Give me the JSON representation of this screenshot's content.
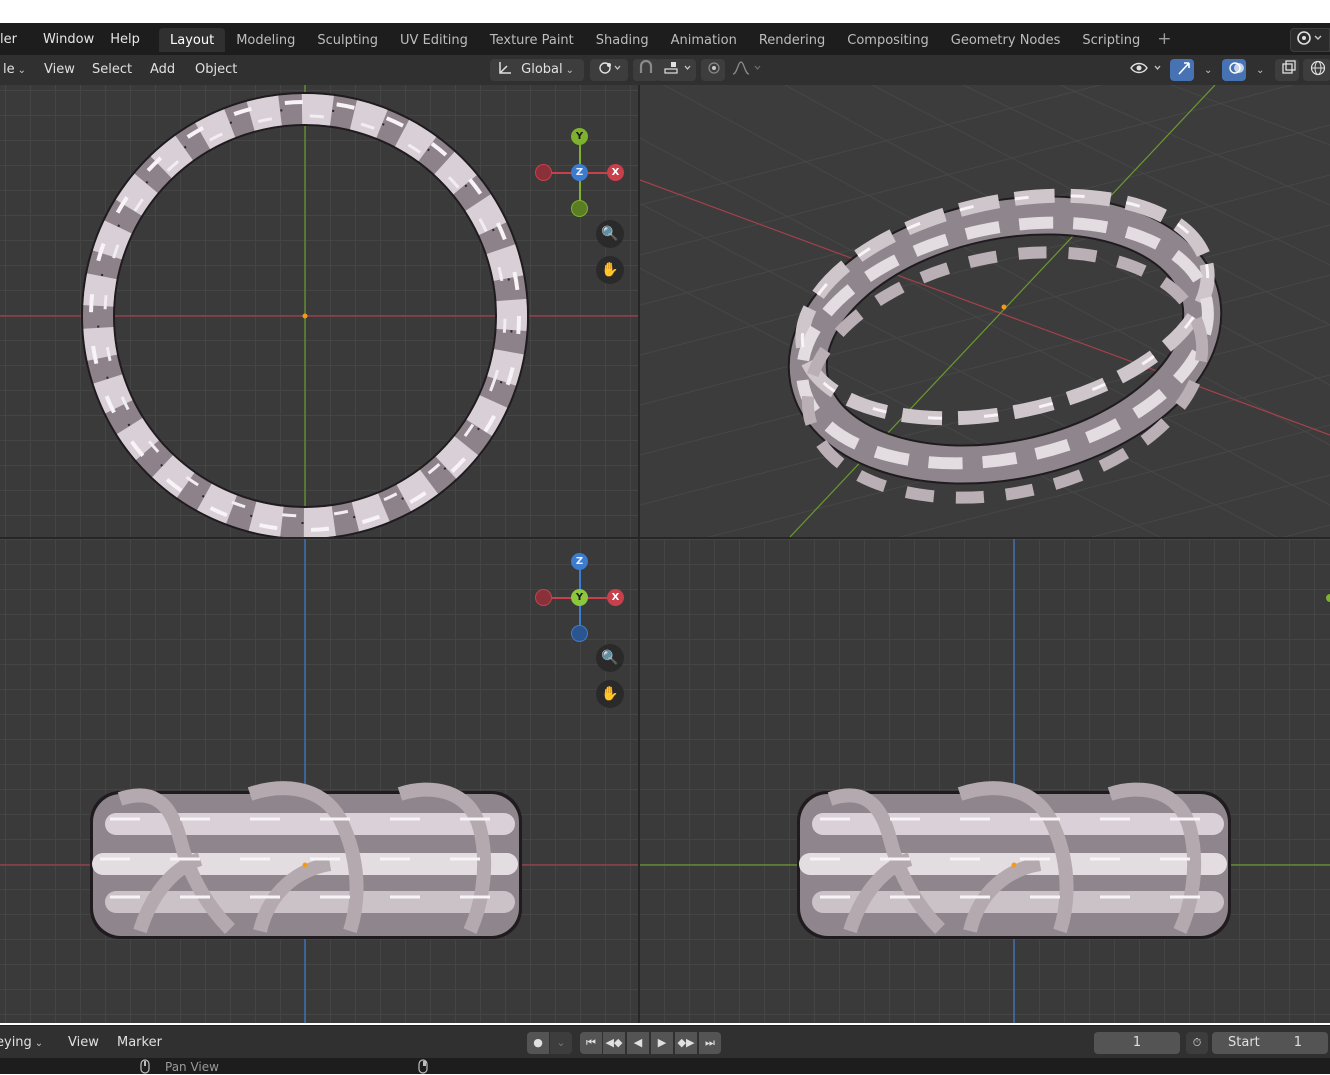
{
  "menu": {
    "items": [
      "ler",
      "Window",
      "Help"
    ]
  },
  "workspaces": {
    "tabs": [
      "Layout",
      "Modeling",
      "Sculpting",
      "UV Editing",
      "Texture Paint",
      "Shading",
      "Animation",
      "Rendering",
      "Compositing",
      "Geometry Nodes",
      "Scripting"
    ],
    "active": "Layout",
    "add_label": "+"
  },
  "viewport_header": {
    "mode_label": "le",
    "menus": [
      "View",
      "Select",
      "Add",
      "Object"
    ],
    "orientation_label": "Global"
  },
  "gizmo_top": {
    "y": "Y",
    "z": "Z",
    "x": "X"
  },
  "gizmo_front": {
    "z": "Z",
    "y": "Y",
    "x": "X"
  },
  "timeline": {
    "keying_label": "eying",
    "view_label": "View",
    "marker_label": "Marker",
    "current_frame": "1",
    "start_label": "Start",
    "start_value": "1"
  },
  "status": {
    "pan_view_label": "Pan View"
  },
  "colors": {
    "x_axis": "#c8404c",
    "y_axis": "#7fb130",
    "z_axis": "#3b7cd0",
    "origin": "#f29a1a",
    "active_tab": "#303030",
    "button_blue": "#4772b3"
  },
  "icons": [
    "transform-orientation-icon",
    "pivot-icon",
    "snap-icon",
    "proportional-edit-icon",
    "zoom-icon",
    "hand-icon",
    "visibility-icon",
    "gizmo-icon",
    "overlay-icon",
    "xray-icon",
    "shading-wire-icon",
    "record-icon",
    "jump-start-icon",
    "prev-keyframe-icon",
    "play-reverse-icon",
    "play-icon",
    "next-keyframe-icon",
    "jump-end-icon",
    "clock-icon",
    "mouse-icon"
  ]
}
